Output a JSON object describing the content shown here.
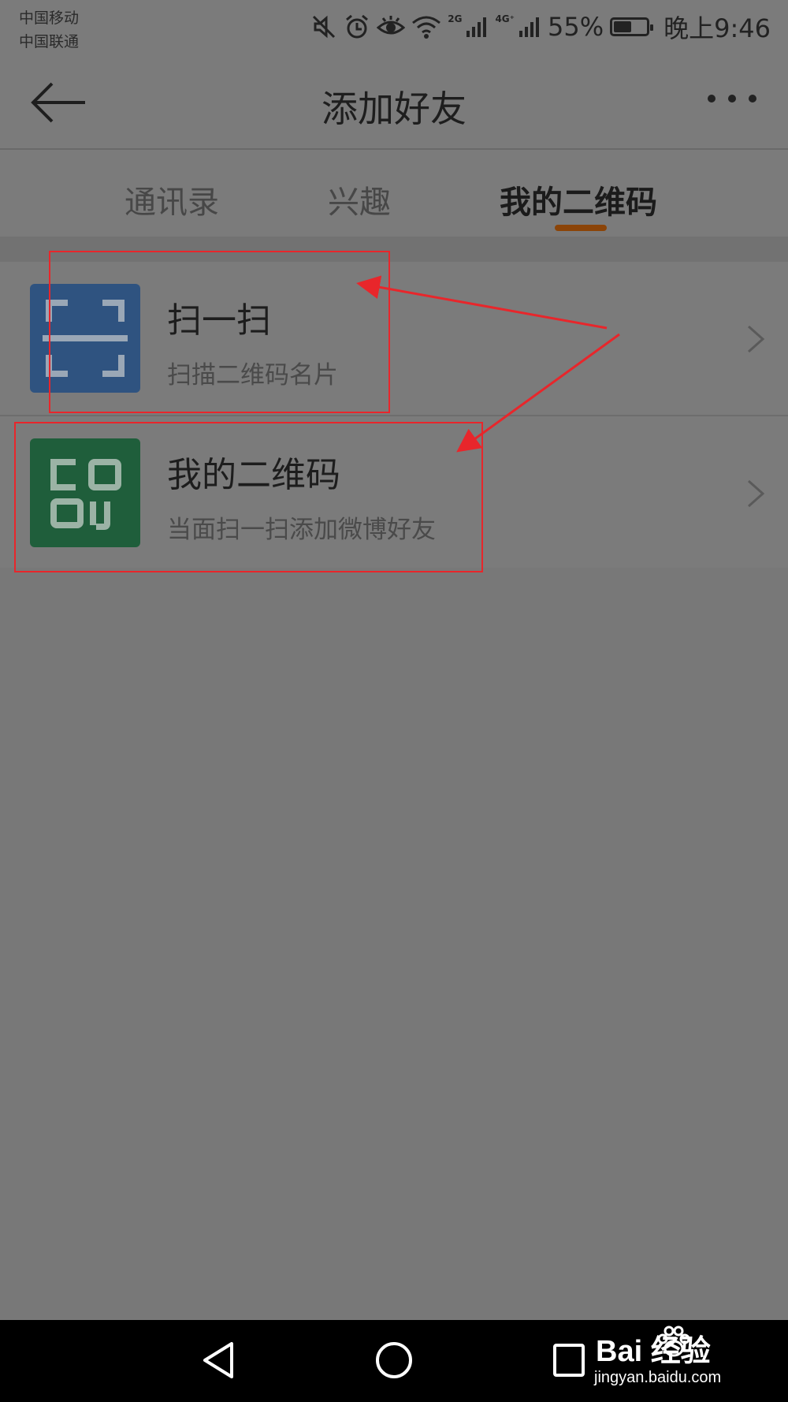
{
  "status_bar": {
    "carrier_1": "中国移动",
    "carrier_2": "中国联通",
    "net_2g": "2G",
    "net_4g": "4G⁺",
    "battery_percent": "55%",
    "battery_level": 0.55,
    "time": "晚上9:46",
    "icons": [
      "mute-icon",
      "alarm-icon",
      "eye-icon",
      "wifi-icon",
      "signal-2g-icon",
      "signal-4g-icon",
      "battery-icon"
    ]
  },
  "header": {
    "title": "添加好友",
    "back_icon": "back-arrow-icon",
    "more_icon": "more-dots-icon"
  },
  "tabs": [
    {
      "label": "通讯录",
      "active": false
    },
    {
      "label": "兴趣",
      "active": false
    },
    {
      "label": "我的二维码",
      "active": true
    }
  ],
  "list": [
    {
      "title": "扫一扫",
      "subtitle": "扫描二维码名片",
      "icon": "scan-icon",
      "icon_color": "#2f5380"
    },
    {
      "title": "我的二维码",
      "subtitle": "当面扫一扫添加微博好友",
      "icon": "qr-code-icon",
      "icon_color": "#1f5e3b"
    }
  ],
  "annotation_color": "#e8262b",
  "nav_bar": {
    "buttons": [
      "back-triangle-icon",
      "home-circle-icon",
      "recents-square-icon"
    ]
  },
  "watermark": {
    "brand": "Bai  经验",
    "url": "jingyan.baidu.com"
  }
}
